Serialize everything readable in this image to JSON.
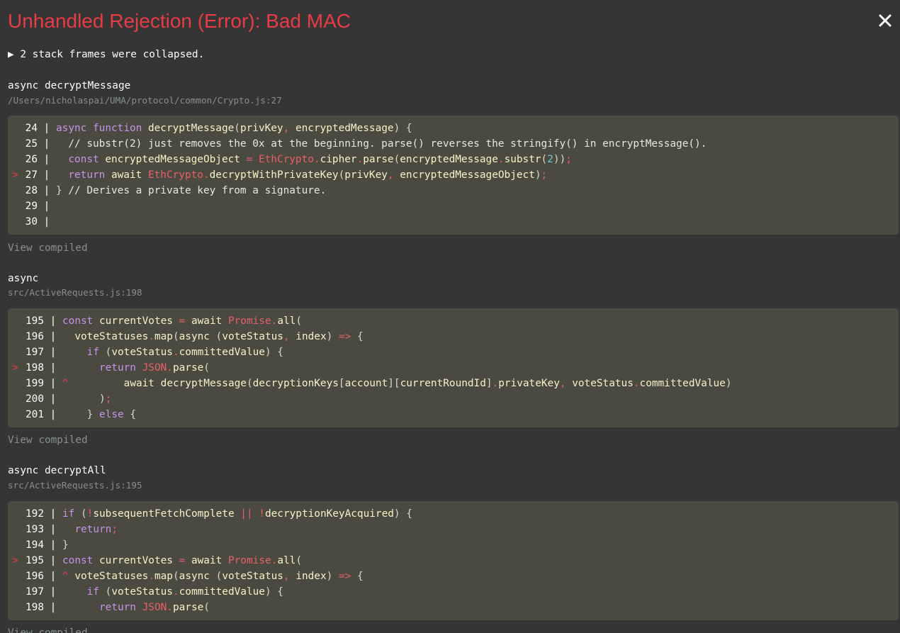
{
  "header": {
    "title": "Unhandled Rejection (Error): Bad MAC",
    "close_glyph": "×"
  },
  "collapsed_toggle": {
    "label": "▶ 2 stack frames were collapsed."
  },
  "colors": {
    "error_red": "#e83b46",
    "background": "#353535",
    "code_background": "#4a4a40",
    "muted": "#878e91"
  },
  "frames": [
    {
      "function": "async decryptMessage",
      "file": "/Users/nicholaspai/UMA/protocol/common/Crypto.js:27",
      "view_compiled": "View compiled",
      "lines": [
        {
          "marker": "",
          "num": "24",
          "tokens": [
            [
              "kw",
              "async"
            ],
            [
              "plain",
              " "
            ],
            [
              "kw",
              "function"
            ],
            [
              "plain",
              " "
            ],
            [
              "id",
              "decryptMessage"
            ],
            [
              "punc",
              "("
            ],
            [
              "id",
              "privKey"
            ],
            [
              "op",
              ","
            ],
            [
              "plain",
              " "
            ],
            [
              "id",
              "encryptedMessage"
            ],
            [
              "punc",
              ")"
            ],
            [
              "plain",
              " "
            ],
            [
              "punc",
              "{"
            ]
          ]
        },
        {
          "marker": "",
          "num": "25",
          "tokens": [
            [
              "plain",
              "  "
            ],
            [
              "cm",
              "// substr(2) just removes the 0x at the beginning. parse() reverses the stringify() in encryptMessage()."
            ]
          ]
        },
        {
          "marker": "",
          "num": "26",
          "tokens": [
            [
              "plain",
              "  "
            ],
            [
              "kw",
              "const"
            ],
            [
              "plain",
              " "
            ],
            [
              "id",
              "encryptedMessageObject"
            ],
            [
              "plain",
              " "
            ],
            [
              "op",
              "="
            ],
            [
              "plain",
              " "
            ],
            [
              "glob",
              "EthCrypto"
            ],
            [
              "op",
              "."
            ],
            [
              "id",
              "cipher"
            ],
            [
              "op",
              "."
            ],
            [
              "id",
              "parse"
            ],
            [
              "punc",
              "("
            ],
            [
              "id",
              "encryptedMessage"
            ],
            [
              "op",
              "."
            ],
            [
              "id",
              "substr"
            ],
            [
              "punc",
              "("
            ],
            [
              "num",
              "2"
            ],
            [
              "punc",
              ")"
            ],
            [
              "punc",
              ")"
            ],
            [
              "op",
              ";"
            ]
          ]
        },
        {
          "marker": ">",
          "num": "27",
          "tokens": [
            [
              "plain",
              "  "
            ],
            [
              "kw",
              "return"
            ],
            [
              "plain",
              " "
            ],
            [
              "id",
              "await"
            ],
            [
              "plain",
              " "
            ],
            [
              "glob",
              "EthCrypto"
            ],
            [
              "op",
              "."
            ],
            [
              "id",
              "decryptWithPrivateKey"
            ],
            [
              "punc",
              "("
            ],
            [
              "id",
              "privKey"
            ],
            [
              "op",
              ","
            ],
            [
              "plain",
              " "
            ],
            [
              "id",
              "encryptedMessageObject"
            ],
            [
              "punc",
              ")"
            ],
            [
              "op",
              ";"
            ]
          ]
        },
        {
          "marker": "",
          "num": "28",
          "tokens": [
            [
              "punc",
              "}"
            ],
            [
              "plain",
              " "
            ],
            [
              "cm",
              "// Derives a private key from a signature."
            ]
          ]
        },
        {
          "marker": "",
          "num": "29",
          "tokens": []
        },
        {
          "marker": "",
          "num": "30",
          "tokens": []
        }
      ]
    },
    {
      "function": "async",
      "file": "src/ActiveRequests.js:198",
      "view_compiled": "View compiled",
      "lines": [
        {
          "marker": "",
          "num": "195",
          "tokens": [
            [
              "kw",
              "const"
            ],
            [
              "plain",
              " "
            ],
            [
              "id",
              "currentVotes"
            ],
            [
              "plain",
              " "
            ],
            [
              "op",
              "="
            ],
            [
              "plain",
              " "
            ],
            [
              "id",
              "await"
            ],
            [
              "plain",
              " "
            ],
            [
              "glob",
              "Promise"
            ],
            [
              "op",
              "."
            ],
            [
              "id",
              "all"
            ],
            [
              "punc",
              "("
            ]
          ]
        },
        {
          "marker": "",
          "num": "196",
          "tokens": [
            [
              "plain",
              "  "
            ],
            [
              "id",
              "voteStatuses"
            ],
            [
              "op",
              "."
            ],
            [
              "id",
              "map"
            ],
            [
              "punc",
              "("
            ],
            [
              "id",
              "async"
            ],
            [
              "plain",
              " "
            ],
            [
              "punc",
              "("
            ],
            [
              "id",
              "voteStatus"
            ],
            [
              "op",
              ","
            ],
            [
              "plain",
              " "
            ],
            [
              "id",
              "index"
            ],
            [
              "punc",
              ")"
            ],
            [
              "plain",
              " "
            ],
            [
              "op",
              "=>"
            ],
            [
              "plain",
              " "
            ],
            [
              "punc",
              "{"
            ]
          ]
        },
        {
          "marker": "",
          "num": "197",
          "tokens": [
            [
              "plain",
              "    "
            ],
            [
              "kw",
              "if"
            ],
            [
              "plain",
              " "
            ],
            [
              "punc",
              "("
            ],
            [
              "id",
              "voteStatus"
            ],
            [
              "op",
              "."
            ],
            [
              "id",
              "committedValue"
            ],
            [
              "punc",
              ")"
            ],
            [
              "plain",
              " "
            ],
            [
              "punc",
              "{"
            ]
          ]
        },
        {
          "marker": ">",
          "num": "198",
          "tokens": [
            [
              "plain",
              "      "
            ],
            [
              "kw",
              "return"
            ],
            [
              "plain",
              " "
            ],
            [
              "glob",
              "JSON"
            ],
            [
              "op",
              "."
            ],
            [
              "id",
              "parse"
            ],
            [
              "punc",
              "("
            ]
          ]
        },
        {
          "marker": "",
          "num": "199",
          "caret": "^",
          "tokens": [
            [
              "plain",
              "        "
            ],
            [
              "id",
              "await"
            ],
            [
              "plain",
              " "
            ],
            [
              "id",
              "decryptMessage"
            ],
            [
              "punc",
              "("
            ],
            [
              "id",
              "decryptionKeys"
            ],
            [
              "punc",
              "["
            ],
            [
              "id",
              "account"
            ],
            [
              "punc",
              "]"
            ],
            [
              "punc",
              "["
            ],
            [
              "id",
              "currentRoundId"
            ],
            [
              "punc",
              "]"
            ],
            [
              "op",
              "."
            ],
            [
              "id",
              "privateKey"
            ],
            [
              "op",
              ","
            ],
            [
              "plain",
              " "
            ],
            [
              "id",
              "voteStatus"
            ],
            [
              "op",
              "."
            ],
            [
              "id",
              "committedValue"
            ],
            [
              "punc",
              ")"
            ]
          ]
        },
        {
          "marker": "",
          "num": "200",
          "tokens": [
            [
              "plain",
              "      "
            ],
            [
              "punc",
              ")"
            ],
            [
              "op",
              ";"
            ]
          ]
        },
        {
          "marker": "",
          "num": "201",
          "tokens": [
            [
              "plain",
              "    "
            ],
            [
              "punc",
              "}"
            ],
            [
              "plain",
              " "
            ],
            [
              "kw",
              "else"
            ],
            [
              "plain",
              " "
            ],
            [
              "punc",
              "{"
            ]
          ]
        }
      ]
    },
    {
      "function": "async decryptAll",
      "file": "src/ActiveRequests.js:195",
      "view_compiled": "View compiled",
      "lines": [
        {
          "marker": "",
          "num": "192",
          "tokens": [
            [
              "kw",
              "if"
            ],
            [
              "plain",
              " "
            ],
            [
              "punc",
              "("
            ],
            [
              "op",
              "!"
            ],
            [
              "id",
              "subsequentFetchComplete"
            ],
            [
              "plain",
              " "
            ],
            [
              "op",
              "||"
            ],
            [
              "plain",
              " "
            ],
            [
              "op",
              "!"
            ],
            [
              "id",
              "decryptionKeyAcquired"
            ],
            [
              "punc",
              ")"
            ],
            [
              "plain",
              " "
            ],
            [
              "punc",
              "{"
            ]
          ]
        },
        {
          "marker": "",
          "num": "193",
          "tokens": [
            [
              "plain",
              "  "
            ],
            [
              "kw",
              "return"
            ],
            [
              "op",
              ";"
            ]
          ]
        },
        {
          "marker": "",
          "num": "194",
          "tokens": [
            [
              "punc",
              "}"
            ]
          ]
        },
        {
          "marker": ">",
          "num": "195",
          "tokens": [
            [
              "kw",
              "const"
            ],
            [
              "plain",
              " "
            ],
            [
              "id",
              "currentVotes"
            ],
            [
              "plain",
              " "
            ],
            [
              "op",
              "="
            ],
            [
              "plain",
              " "
            ],
            [
              "id",
              "await"
            ],
            [
              "plain",
              " "
            ],
            [
              "glob",
              "Promise"
            ],
            [
              "op",
              "."
            ],
            [
              "id",
              "all"
            ],
            [
              "punc",
              "("
            ]
          ]
        },
        {
          "marker": "",
          "num": "196",
          "caret": "^",
          "tokens": [
            [
              "id",
              "voteStatuses"
            ],
            [
              "op",
              "."
            ],
            [
              "id",
              "map"
            ],
            [
              "punc",
              "("
            ],
            [
              "id",
              "async"
            ],
            [
              "plain",
              " "
            ],
            [
              "punc",
              "("
            ],
            [
              "id",
              "voteStatus"
            ],
            [
              "op",
              ","
            ],
            [
              "plain",
              " "
            ],
            [
              "id",
              "index"
            ],
            [
              "punc",
              ")"
            ],
            [
              "plain",
              " "
            ],
            [
              "op",
              "=>"
            ],
            [
              "plain",
              " "
            ],
            [
              "punc",
              "{"
            ]
          ]
        },
        {
          "marker": "",
          "num": "197",
          "tokens": [
            [
              "plain",
              "    "
            ],
            [
              "kw",
              "if"
            ],
            [
              "plain",
              " "
            ],
            [
              "punc",
              "("
            ],
            [
              "id",
              "voteStatus"
            ],
            [
              "op",
              "."
            ],
            [
              "id",
              "committedValue"
            ],
            [
              "punc",
              ")"
            ],
            [
              "plain",
              " "
            ],
            [
              "punc",
              "{"
            ]
          ]
        },
        {
          "marker": "",
          "num": "198",
          "tokens": [
            [
              "plain",
              "      "
            ],
            [
              "kw",
              "return"
            ],
            [
              "plain",
              " "
            ],
            [
              "glob",
              "JSON"
            ],
            [
              "op",
              "."
            ],
            [
              "id",
              "parse"
            ],
            [
              "punc",
              "("
            ]
          ]
        }
      ]
    }
  ]
}
